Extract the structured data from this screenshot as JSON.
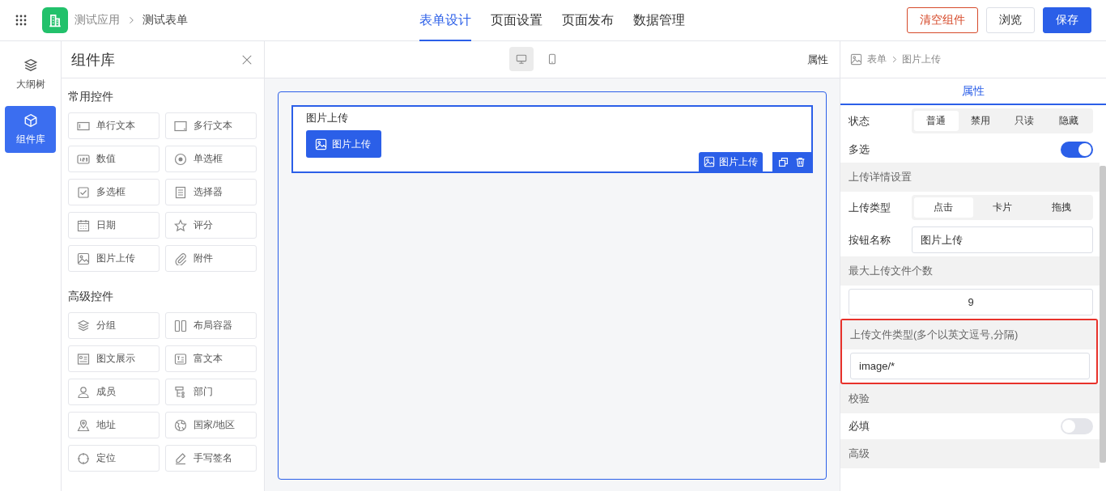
{
  "topbar": {
    "app_name": "测试应用",
    "form_name": "测试表单",
    "nav": [
      {
        "label": "表单设计",
        "selected": true
      },
      {
        "label": "页面设置",
        "selected": false
      },
      {
        "label": "页面发布",
        "selected": false
      },
      {
        "label": "数据管理",
        "selected": false
      }
    ],
    "buttons": [
      {
        "label": "清空组件",
        "kind": "danger"
      },
      {
        "label": "浏览",
        "kind": "default"
      },
      {
        "label": "保存",
        "kind": "primary"
      }
    ]
  },
  "rail": [
    {
      "label": "大纲树",
      "selected": false
    },
    {
      "label": "组件库",
      "selected": true
    }
  ],
  "library": {
    "title": "组件库",
    "groups": [
      {
        "title": "常用控件",
        "items": [
          "单行文本",
          "多行文本",
          "数值",
          "单选框",
          "多选框",
          "选择器",
          "日期",
          "评分",
          "图片上传",
          "附件"
        ]
      },
      {
        "title": "高级控件",
        "items": [
          "分组",
          "布局容器",
          "图文展示",
          "富文本",
          "成员",
          "部门",
          "地址",
          "国家/地区",
          "定位",
          "手写签名"
        ]
      }
    ]
  },
  "canvas": {
    "devices": [
      {
        "selected": true
      },
      {
        "selected": false
      }
    ],
    "panel_label": "属性",
    "field": {
      "label": "图片上传",
      "button": "图片上传",
      "tag": "图片上传",
      "selected": true
    }
  },
  "properties": {
    "breadcrumb": [
      "表单",
      "图片上传"
    ],
    "tabs": [
      {
        "label": "属性",
        "selected": true
      }
    ],
    "rows": [
      {
        "kind": "segmented",
        "label": "状态",
        "options": [
          {
            "label": "普通",
            "selected": true
          },
          {
            "label": "禁用",
            "selected": false
          },
          {
            "label": "只读",
            "selected": false
          },
          {
            "label": "隐藏",
            "selected": false
          }
        ]
      },
      {
        "kind": "switch",
        "label": "多选",
        "on": true
      },
      {
        "kind": "section",
        "title": "上传详情设置",
        "highlighted": false
      },
      {
        "kind": "segmented",
        "label": "上传类型",
        "options": [
          {
            "label": "点击",
            "selected": true
          },
          {
            "label": "卡片",
            "selected": false
          },
          {
            "label": "拖拽",
            "selected": false
          }
        ]
      },
      {
        "kind": "input",
        "label": "按钮名称",
        "value": "图片上传"
      },
      {
        "kind": "section",
        "title": "最大上传文件个数",
        "highlighted": false
      },
      {
        "kind": "number",
        "value": "9"
      },
      {
        "kind": "section",
        "title": "上传文件类型(多个以英文逗号,分隔)",
        "highlighted": true,
        "value": "image/*"
      },
      {
        "kind": "section",
        "title": "校验",
        "highlighted": false
      },
      {
        "kind": "switch",
        "label": "必填",
        "on": false
      },
      {
        "kind": "section",
        "title": "高级",
        "highlighted": false
      }
    ]
  }
}
